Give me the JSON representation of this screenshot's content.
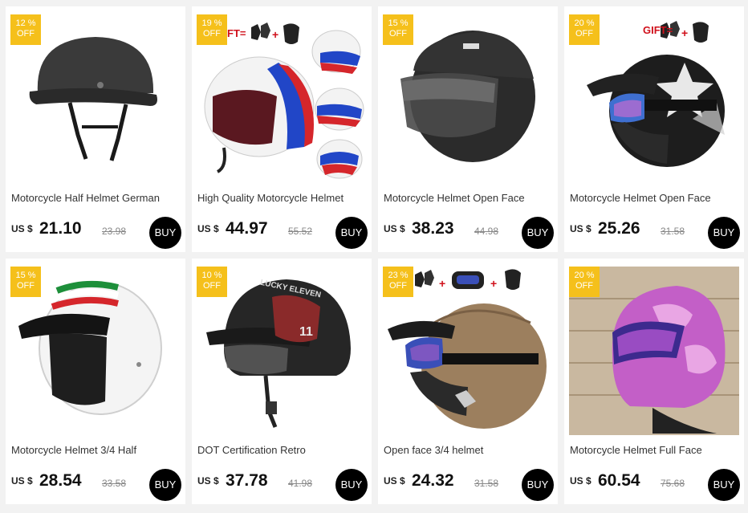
{
  "products": [
    {
      "discount": "12 %",
      "off": "OFF",
      "title": "Motorcycle Half Helmet German",
      "currency": "US $",
      "price": "21.10",
      "old_price": "23.98",
      "buy": "BUY"
    },
    {
      "discount": "19 %",
      "off": "OFF",
      "title": "High Quality Motorcycle Helmet",
      "currency": "US $",
      "price": "44.97",
      "old_price": "55.52",
      "buy": "BUY",
      "gift_text": "FT="
    },
    {
      "discount": "15 %",
      "off": "OFF",
      "title": "Motorcycle Helmet Open Face",
      "currency": "US $",
      "price": "38.23",
      "old_price": "44.98",
      "buy": "BUY"
    },
    {
      "discount": "20 %",
      "off": "OFF",
      "title": "Motorcycle Helmet Open Face",
      "currency": "US $",
      "price": "25.26",
      "old_price": "31.58",
      "buy": "BUY",
      "gift_text": "GIFT="
    },
    {
      "discount": "15 %",
      "off": "OFF",
      "title": "Motorcycle Helmet 3/4 Half",
      "currency": "US $",
      "price": "28.54",
      "old_price": "33.58",
      "buy": "BUY"
    },
    {
      "discount": "10 %",
      "off": "OFF",
      "title": "DOT Certification Retro",
      "currency": "US $",
      "price": "37.78",
      "old_price": "41.98",
      "buy": "BUY",
      "helmet_print": "LUCKY ELEVEN"
    },
    {
      "discount": "23 %",
      "off": "OFF",
      "title": "Open face 3/4 helmet",
      "currency": "US $",
      "price": "24.32",
      "old_price": "31.58",
      "buy": "BUY"
    },
    {
      "discount": "20 %",
      "off": "OFF",
      "title": "Motorcycle Helmet Full Face",
      "currency": "US $",
      "price": "60.54",
      "old_price": "75.68",
      "buy": "BUY"
    }
  ],
  "colors": {
    "badge": "#f5c01b",
    "buy_button": "#000000",
    "gift_red": "#d0101b"
  },
  "icons": [
    "helmet-image",
    "gloves-icon",
    "mask-icon",
    "goggles-icon"
  ]
}
